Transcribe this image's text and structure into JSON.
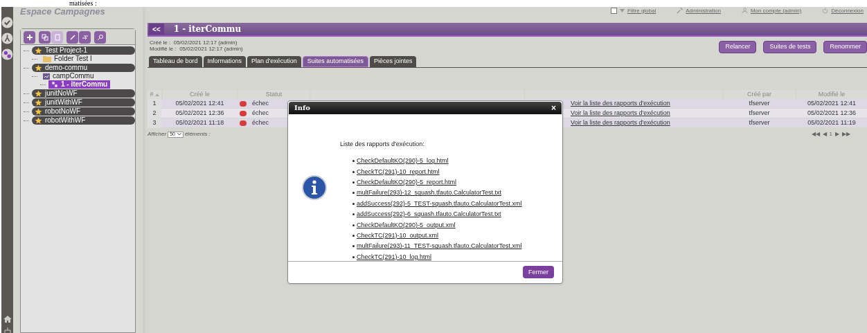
{
  "clipped_heading": "matisées :",
  "space_title": "Espace Campagnes",
  "top_links": [
    {
      "kind": "checkbox",
      "label": "Filtre global",
      "checked": false
    },
    {
      "kind": "admin",
      "label": "Administration"
    },
    {
      "kind": "account",
      "label": "Mon compte (admin)"
    },
    {
      "kind": "logout",
      "label": "Déconnexion"
    }
  ],
  "tree_toolbar": [
    {
      "kind": "add",
      "disabled": false
    },
    {
      "kind": "copy",
      "disabled": false
    },
    {
      "kind": "paste",
      "disabled": true
    },
    {
      "kind": "rename",
      "disabled": false
    },
    {
      "kind": "move",
      "disabled": false
    },
    {
      "kind": "search",
      "disabled": false
    }
  ],
  "tree": [
    {
      "kind": "project",
      "label": "Test Project-1",
      "selected": false,
      "children": [
        {
          "kind": "folder",
          "label": "Folder Test I",
          "selected": false
        }
      ]
    },
    {
      "kind": "project",
      "label": "demo-commu",
      "selected": false,
      "children": [
        {
          "kind": "campaign",
          "label": "campCommu",
          "selected": false,
          "children": [
            {
              "kind": "iteration",
              "label": "1 - iterCommu",
              "selected": true
            }
          ]
        }
      ]
    },
    {
      "kind": "project",
      "label": "junitNoWF",
      "selected": false
    },
    {
      "kind": "project",
      "label": "junitWithWF",
      "selected": false
    },
    {
      "kind": "project",
      "label": "robotNoWF",
      "selected": false
    },
    {
      "kind": "project",
      "label": "robotWithWF",
      "selected": false
    }
  ],
  "header": {
    "back": "<<",
    "title": "1 - iterCommu"
  },
  "meta": [
    "Créé le :  05/02/2021 12:17 (admin)",
    "Modifié le :  05/02/2021 12:17 (admin)"
  ],
  "actions": [
    "Relancer",
    "Suites de tests",
    "Renommer"
  ],
  "tabs": [
    {
      "label": "Tableau de bord",
      "selected": false
    },
    {
      "label": "Informations",
      "selected": false
    },
    {
      "label": "Plan d'exécution",
      "selected": false
    },
    {
      "label": "Suites automatisées",
      "selected": true
    },
    {
      "label": "Pièces jointes",
      "selected": false
    }
  ],
  "table": {
    "columns": [
      {
        "kind": "label",
        "label": "#",
        "sortable": true
      },
      {
        "kind": "label",
        "label": "Créé le"
      },
      {
        "kind": "label",
        "label": "Statut"
      },
      {
        "kind": "blank"
      },
      {
        "kind": "blank"
      },
      {
        "kind": "label",
        "label": "Créé par"
      },
      {
        "kind": "label",
        "label": "Modifié le"
      }
    ],
    "rows": [
      {
        "index": "1",
        "created": "05/02/2021 12:41",
        "status": "échec",
        "color": "#d83b3b",
        "link": "Voir la liste des rapports d'exécution",
        "created_by": "tfserver",
        "modified": "05/02/2021 12:41"
      },
      {
        "index": "2",
        "created": "05/02/2021 12:36",
        "status": "échec",
        "color": "#d83b3b",
        "link": "Voir la liste des rapports d'exécution",
        "created_by": "tfserver",
        "modified": "05/02/2021 12:36"
      },
      {
        "index": "3",
        "created": "05/02/2021 11:18",
        "status": "échec",
        "color": "#d83b3b",
        "link": "Voir la liste des rapports d'exécution",
        "created_by": "tfserver",
        "modified": "05/02/2021 11:19"
      }
    ],
    "page_size": {
      "before": "Afficher",
      "value": "50",
      "after": "éléments :"
    },
    "pagination": [
      "◀◀",
      "◀",
      "1",
      "▶",
      "▶▶"
    ]
  },
  "dialog": {
    "title": "Info",
    "close": "×",
    "intro": "Liste des rapports d'exécution:",
    "reports": [
      "CheckDefaultKO(290)-5_log.html",
      "CheckTC(291)-10_report.html",
      "CheckDefaultKO(290)-5_report.html",
      "multFailure(293)-12_squash.tfauto.CalculatorTest.txt",
      "addSuccess(292)-5_TEST-squash.tfauto.CalculatorTest.xml",
      "addSuccess(292)-6_squash.tfauto.CalculatorTest.txt",
      "CheckDefaultKO(290)-5_output.xml",
      "CheckTC(291)-10_output.xml",
      "multFailure(293)-11_TEST-squash.tfauto.CalculatorTest.xml",
      "CheckTC(291)-10_log.html"
    ],
    "button": "Fermer"
  }
}
